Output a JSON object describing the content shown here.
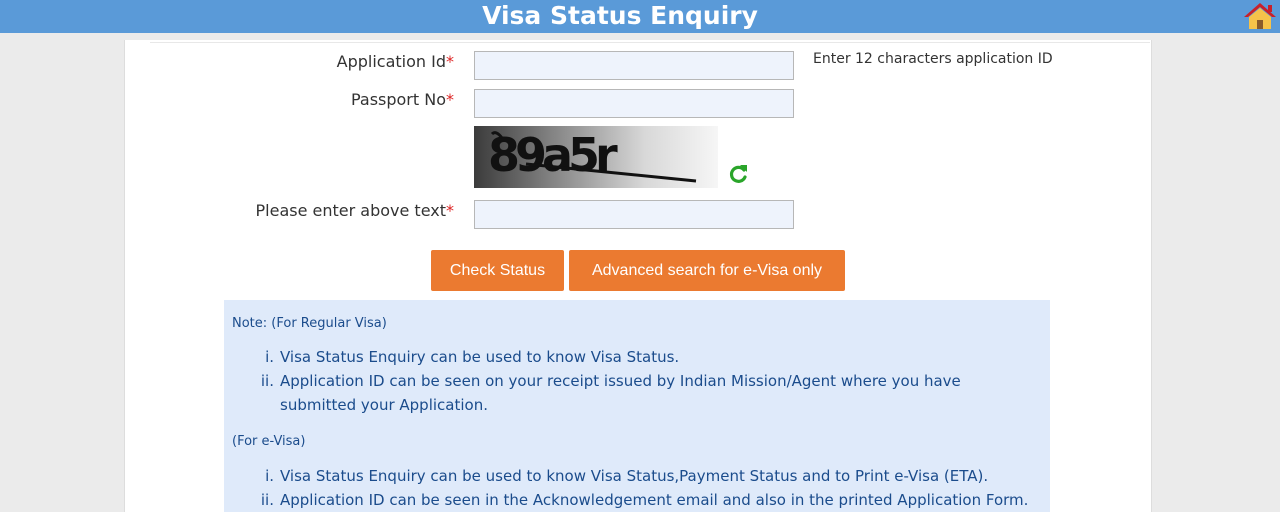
{
  "header": {
    "title": "Visa Status Enquiry",
    "home_icon": "home-icon"
  },
  "form": {
    "application_id": {
      "label": "Application Id",
      "required_mark": "*",
      "value": "",
      "hint": "Enter 12 characters application ID"
    },
    "passport_no": {
      "label": "Passport No",
      "required_mark": "*",
      "value": ""
    },
    "captcha": {
      "text": "89a5r",
      "refresh_icon": "refresh-icon"
    },
    "captcha_input": {
      "label": "Please enter above text",
      "required_mark": "*",
      "value": ""
    }
  },
  "buttons": {
    "check_status": "Check Status",
    "advanced_search": "Advanced search for e-Visa only"
  },
  "notes": {
    "regular_heading": "Note: (For Regular Visa)",
    "regular_items": [
      {
        "num": "i.",
        "text": "Visa Status Enquiry can be used to know Visa Status."
      },
      {
        "num": "ii.",
        "text": "Application ID can be seen on your receipt issued by Indian Mission/Agent where you have submitted your Application."
      }
    ],
    "evisa_heading": "(For e-Visa)",
    "evisa_items": [
      {
        "num": "i.",
        "text": "Visa Status Enquiry can be used to know Visa Status,Payment Status and to Print e-Visa (ETA)."
      },
      {
        "num": "ii.",
        "text": "Application ID can be seen in the Acknowledgement email and also in the printed Application Form."
      }
    ]
  },
  "colors": {
    "header": "#5a9ad8",
    "button": "#eb7a30",
    "note_bg": "#dfeafa",
    "note_text": "#1b4c8c",
    "required": "#dd2222"
  }
}
